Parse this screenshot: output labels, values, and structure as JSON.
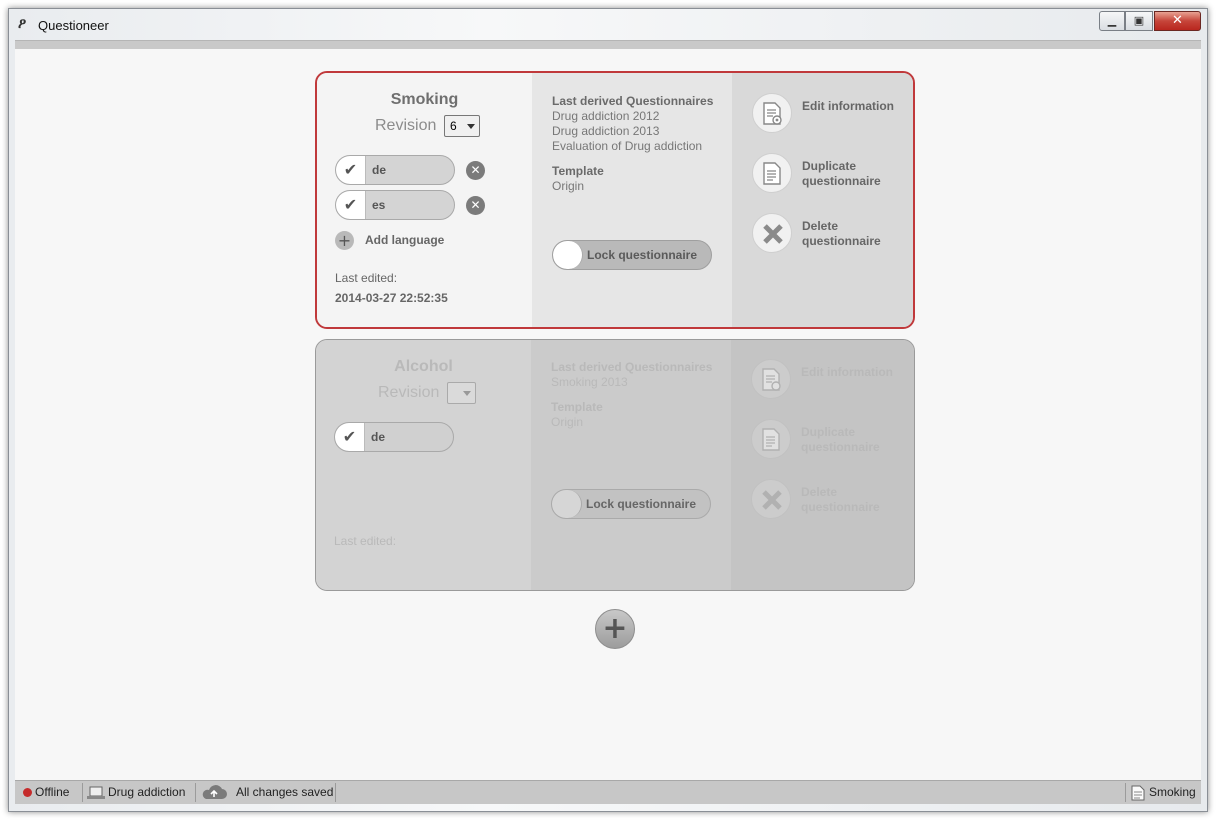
{
  "window": {
    "title": "Questioneer"
  },
  "cards": [
    {
      "name": "Smoking",
      "revision_label": "Revision",
      "revision_value": "6",
      "languages": [
        "de",
        "es"
      ],
      "add_language": "Add language",
      "last_edited_label": "Last edited:",
      "last_edited_value": "2014-03-27 22:52:35",
      "derived_title": "Last derived Questionnaires",
      "derived": [
        "Drug addiction 2012",
        "Drug addiction 2013",
        "Evaluation of Drug addiction"
      ],
      "template_title": "Template",
      "template_value": "Origin",
      "lock_label": "Lock questionnaire",
      "actions": {
        "edit": "Edit information",
        "duplicate": "Duplicate questionnaire",
        "delete": "Delete questionnaire"
      }
    },
    {
      "name": "Alcohol",
      "revision_label": "Revision",
      "revision_value": "",
      "languages": [
        "de"
      ],
      "last_edited_label": "Last edited:",
      "derived_title": "Last derived Questionnaires",
      "derived": [
        "Smoking 2013"
      ],
      "template_title": "Template",
      "template_value": "Origin",
      "lock_label": "Lock questionnaire",
      "actions": {
        "edit": "Edit information",
        "duplicate": "Duplicate questionnaire",
        "delete": "Delete questionnaire"
      }
    }
  ],
  "statusbar": {
    "connection": "Offline",
    "project": "Drug addiction",
    "save_state": "All changes saved",
    "current": "Smoking"
  },
  "colors": {
    "active_border": "#c0393b",
    "offline_dot": "#c52b2b"
  }
}
